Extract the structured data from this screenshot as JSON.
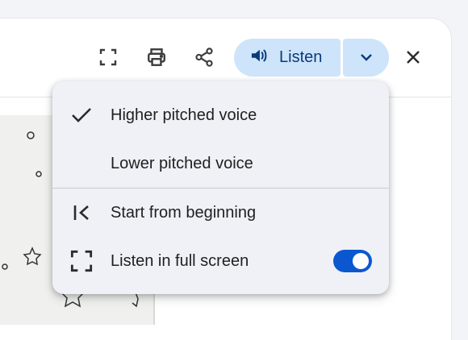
{
  "toolbar": {
    "fullscreen_icon": "fullscreen-icon",
    "print_icon": "print-icon",
    "share_icon": "share-icon",
    "listen_label": "Listen",
    "dropdown_icon": "chevron-down-icon",
    "close_icon": "close-icon"
  },
  "menu": {
    "items": [
      {
        "label": "Higher pitched voice",
        "icon": "check-icon",
        "selected": true
      },
      {
        "label": "Lower pitched voice",
        "icon": "",
        "selected": false
      },
      {
        "label": "Start from beginning",
        "icon": "skip-to-start-icon"
      },
      {
        "label": "Listen in full screen",
        "icon": "fullscreen-icon",
        "toggle_on": true
      }
    ]
  },
  "colors": {
    "accent": "#0b57d0",
    "listen_bg": "#cde4fb",
    "menu_bg": "#eff1f7"
  }
}
